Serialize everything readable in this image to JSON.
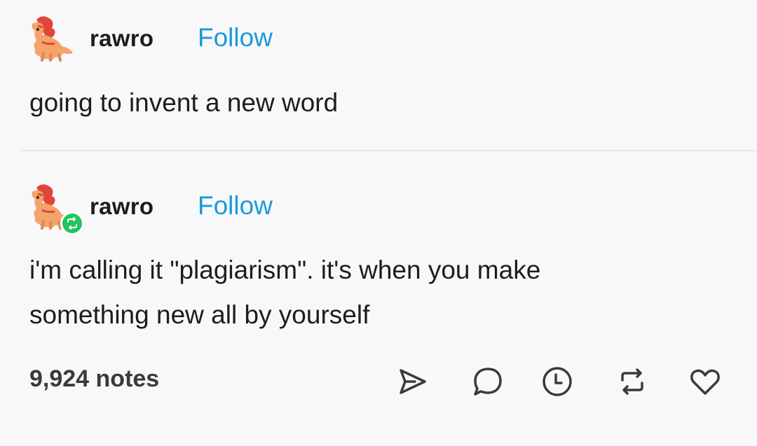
{
  "post1": {
    "username": "rawro",
    "follow_label": "Follow",
    "text": "going to invent a new word"
  },
  "post2": {
    "username": "rawro",
    "follow_label": "Follow",
    "text": "i'm calling it \"plagiarism\". it's when you make\nsomething new all by yourself",
    "notes": "9,924 notes"
  },
  "icons": {
    "avatar": "red-dinosaur-avatar-icon",
    "reblog_badge": "reblog-badge-icon",
    "share": "share-icon",
    "reply": "reply-icon",
    "clock": "clock-icon",
    "reblog": "reblog-icon",
    "like": "heart-icon"
  },
  "colors": {
    "follow": "#1a9bd7",
    "reblog_badge": "#22c55e",
    "background": "#f8f8fa"
  }
}
